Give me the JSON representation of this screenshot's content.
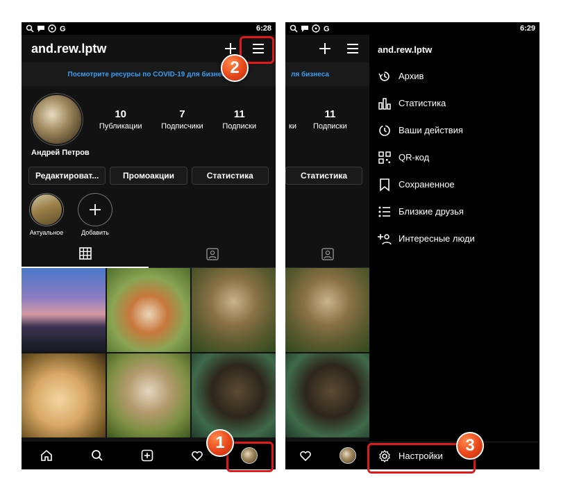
{
  "left": {
    "status_time": "6:28",
    "username": "and.rew.lptw",
    "covid_banner": "Посмотрите ресурсы по COVID-19 для бизнеса",
    "stats": [
      {
        "value": "10",
        "label": "Публикации"
      },
      {
        "value": "7",
        "label": "Подписчики"
      },
      {
        "value": "11",
        "label": "Подписки"
      }
    ],
    "full_name": "Андрей Петров",
    "buttons": [
      "Редактироват...",
      "Промоакции",
      "Статистика"
    ],
    "highlights": [
      {
        "label": "Актуальное",
        "icon": "highlight-thumbnail"
      },
      {
        "label": "Добавить",
        "icon": "plus-icon"
      }
    ]
  },
  "right": {
    "status_time": "6:29",
    "partial_stat": {
      "value": "11",
      "label_left": "ки",
      "label": "Подписки"
    },
    "partial_banner": "ля бизнеса",
    "partial_button": "Статистика",
    "drawer_username": "and.rew.lptw",
    "menu": [
      {
        "label": "Архив",
        "icon": "archive-icon"
      },
      {
        "label": "Статистика",
        "icon": "stats-icon"
      },
      {
        "label": "Ваши действия",
        "icon": "activity-icon"
      },
      {
        "label": "QR-код",
        "icon": "qr-icon"
      },
      {
        "label": "Сохраненное",
        "icon": "bookmark-icon"
      },
      {
        "label": "Близкие друзья",
        "icon": "close-friends-icon"
      },
      {
        "label": "Интересные люди",
        "icon": "discover-people-icon"
      }
    ],
    "settings_label": "Настройки"
  },
  "badges": [
    "1",
    "2",
    "3"
  ],
  "colors": {
    "background": "#121212",
    "accent_link": "#3c9df0",
    "highlight_red": "#e0191b",
    "badge_orange": "#e8461a"
  }
}
